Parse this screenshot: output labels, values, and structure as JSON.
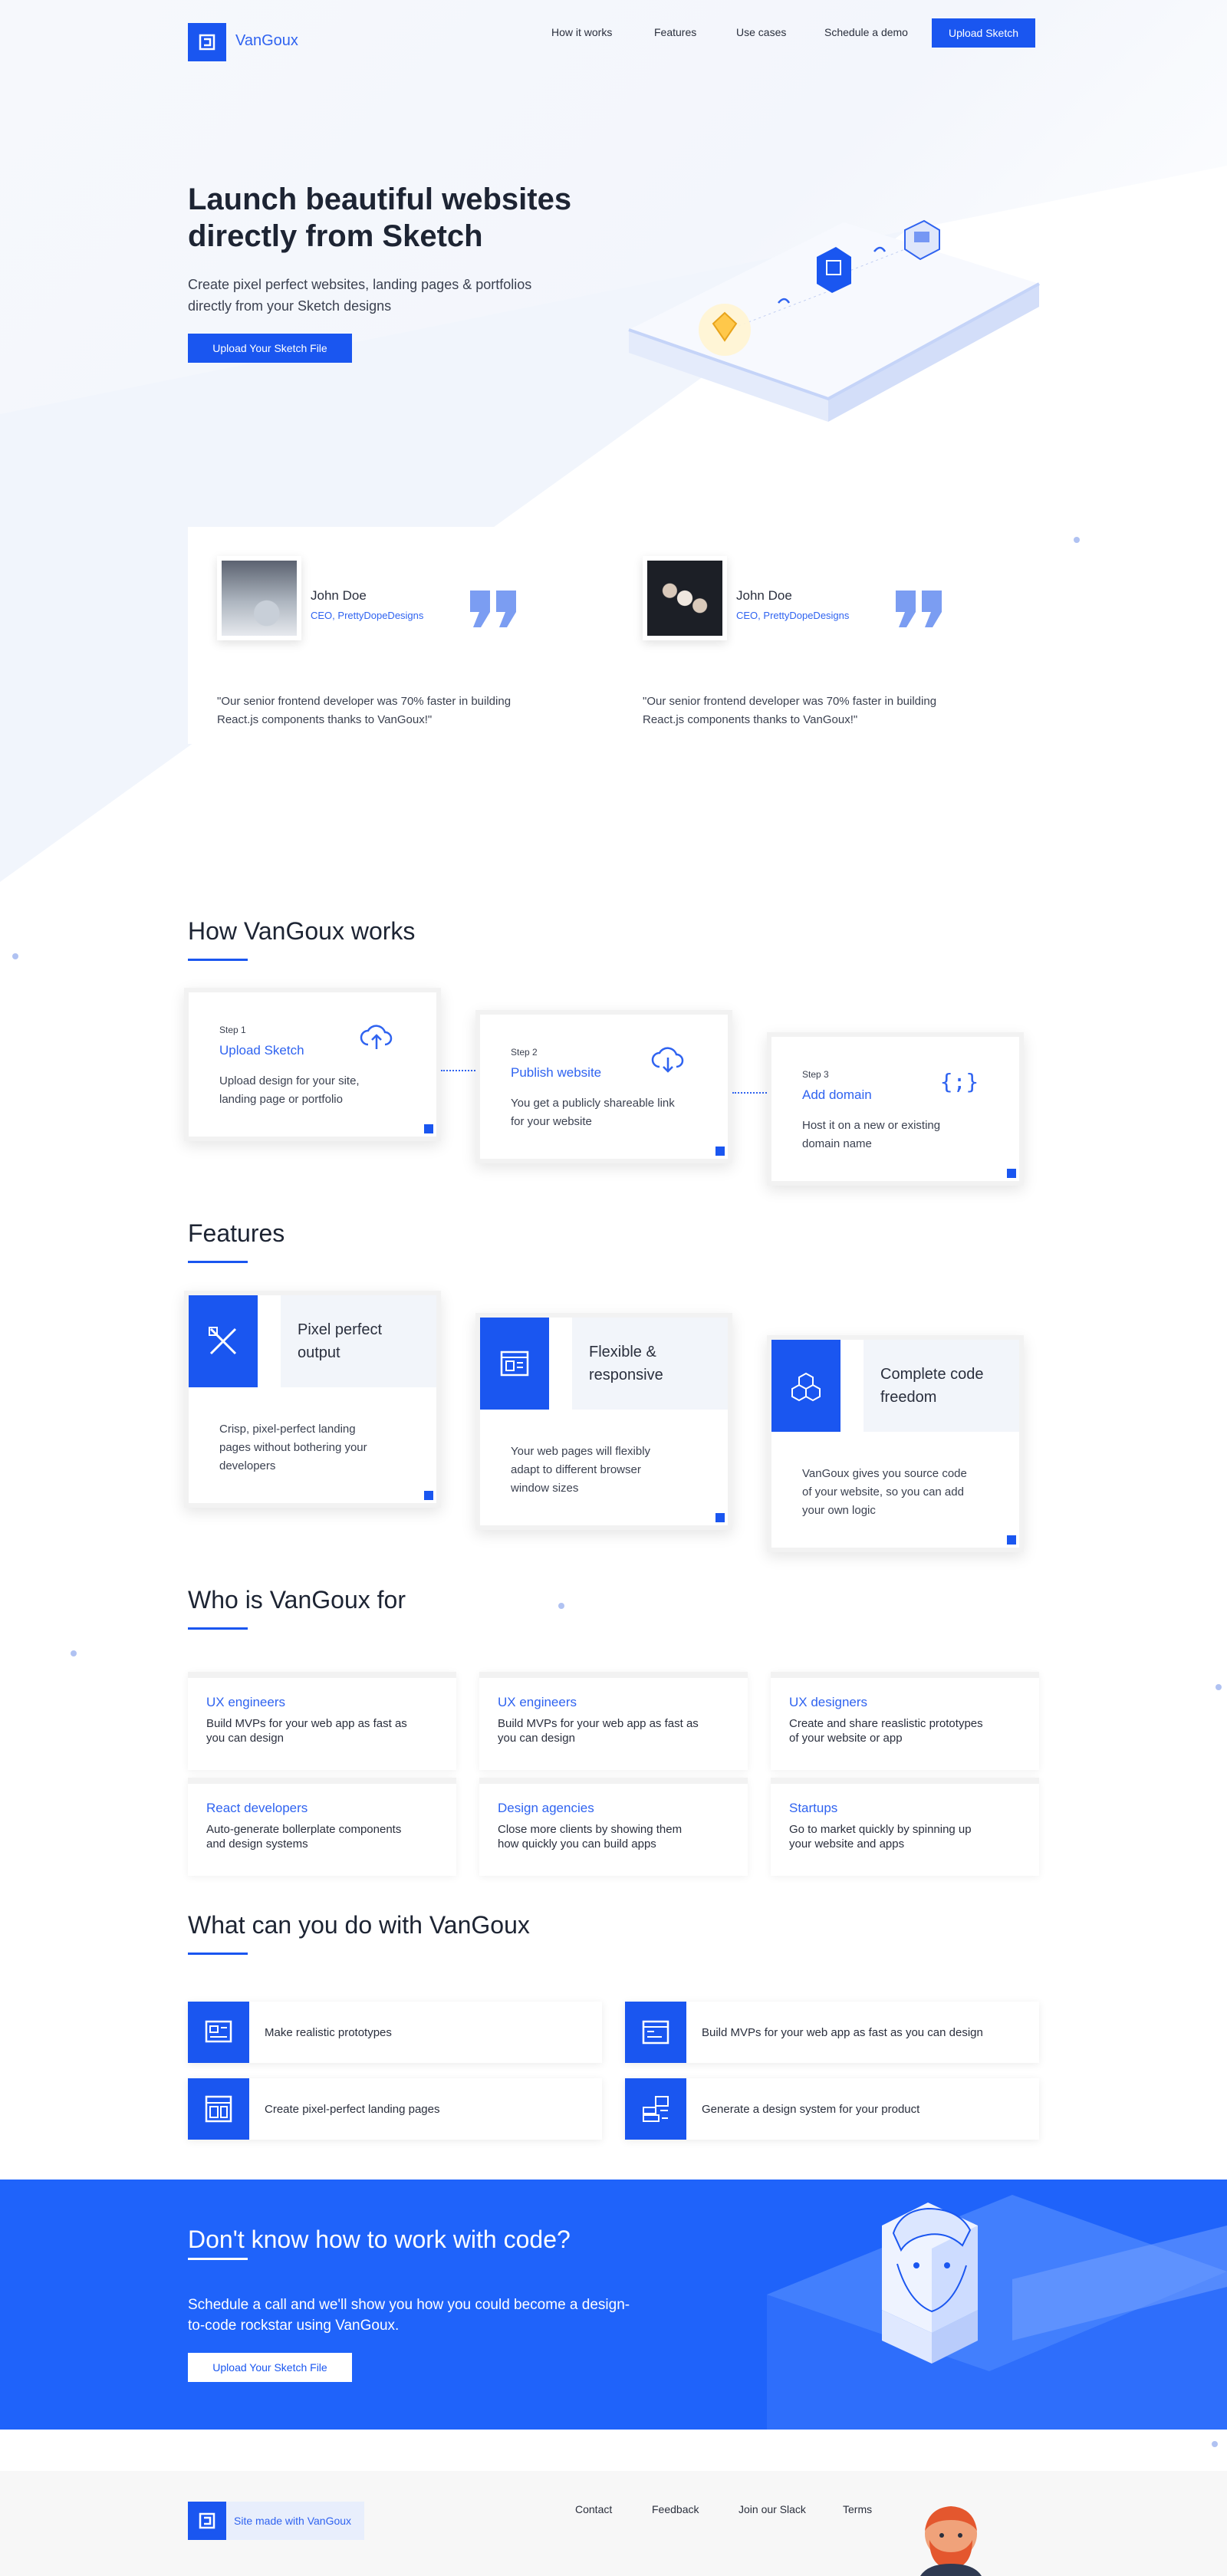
{
  "brand": {
    "name": "VanGoux",
    "accent": "#1a56f0"
  },
  "nav": {
    "items": [
      "How it works",
      "Features",
      "Use cases",
      "Schedule a demo"
    ],
    "cta": "Upload Sketch"
  },
  "hero": {
    "title_line1": "Launch beautiful websites",
    "title_line2": "directly from Sketch",
    "subtitle_line1": "Create pixel perfect websites, landing pages & portfolios",
    "subtitle_line2": "directly from your Sketch designs",
    "button": "Upload Your Sketch File"
  },
  "testimonials": [
    {
      "name": "John Doe",
      "role": "CEO, PrettyDopeDesigns",
      "quote_line1": "\"Our senior frontend developer was 70% faster in building",
      "quote_line2": "React.js components thanks to VanGoux!\""
    },
    {
      "name": "John Doe",
      "role": "CEO, PrettyDopeDesigns",
      "quote_line1": "\"Our senior frontend developer was 70% faster in building",
      "quote_line2": "React.js components thanks to VanGoux!\""
    }
  ],
  "how": {
    "title": "How VanGoux works",
    "steps": [
      {
        "step": "Step 1",
        "title": "Upload Sketch",
        "desc_line1": "Upload design for your site,",
        "desc_line2": "landing page or portfolio",
        "icon": "cloud-upload-icon"
      },
      {
        "step": "Step 2",
        "title": "Publish website",
        "desc_line1": "You get a publicly shareable link",
        "desc_line2": "for your website",
        "icon": "cloud-download-icon"
      },
      {
        "step": "Step 3",
        "title": "Add domain",
        "desc_line1": "Host it on a new or existing",
        "desc_line2": "domain name",
        "icon": "braces-icon"
      }
    ]
  },
  "features": {
    "title": "Features",
    "items": [
      {
        "title_line1": "Pixel perfect",
        "title_line2": "output",
        "desc_line1": "Crisp, pixel-perfect landing",
        "desc_line2": "pages without bothering your",
        "desc_line3": "developers",
        "icon": "ruler-pencil-icon"
      },
      {
        "title_line1": "Flexible &",
        "title_line2": "responsive",
        "desc_line1": "Your web pages will flexibly",
        "desc_line2": "adapt to different browser",
        "desc_line3": "window sizes",
        "icon": "browser-layout-icon"
      },
      {
        "title_line1": "Complete code",
        "title_line2": "freedom",
        "desc_line1": "VanGoux gives you source code",
        "desc_line2": "of your website, so you can add",
        "desc_line3": "your own logic",
        "icon": "cubes-icon"
      }
    ]
  },
  "who": {
    "title": "Who is VanGoux for",
    "items": [
      {
        "title": "UX engineers",
        "desc_line1": "Build MVPs for your web app as fast as",
        "desc_line2": "you can design"
      },
      {
        "title": "UX engineers",
        "desc_line1": "Build MVPs for your web app as fast as",
        "desc_line2": "you can design"
      },
      {
        "title": "UX designers",
        "desc_line1": "Create and share reaslistic prototypes",
        "desc_line2": "of your website or app"
      },
      {
        "title": "React developers",
        "desc_line1": "Auto-generate bollerplate components",
        "desc_line2": "and design systems"
      },
      {
        "title": "Design agencies",
        "desc_line1": "Close more clients by showing them",
        "desc_line2": "how quickly you can build apps"
      },
      {
        "title": "Startups",
        "desc_line1": "Go to market quickly by spinning up",
        "desc_line2": "your website and apps"
      }
    ]
  },
  "cando": {
    "title": "What can you do with VanGoux",
    "items": [
      {
        "text": "Make realistic prototypes",
        "icon": "prototype-icon"
      },
      {
        "text": "Build MVPs for your web app as fast as you can design",
        "icon": "mvp-window-icon"
      },
      {
        "text": "Create pixel-perfect landing pages",
        "icon": "landing-page-icon"
      },
      {
        "text": "Generate a design system for your product",
        "icon": "design-system-icon"
      }
    ]
  },
  "cta": {
    "title": "Don't know how to work with code?",
    "sub_line1": "Schedule a call and we'll show you how you could become a design-",
    "sub_line2": "to-code rockstar using VanGoux.",
    "button": "Upload Your Sketch File"
  },
  "footer": {
    "badge": "Site made with VanGoux",
    "links": [
      "Contact",
      "Feedback",
      "Join our Slack",
      "Terms"
    ]
  }
}
